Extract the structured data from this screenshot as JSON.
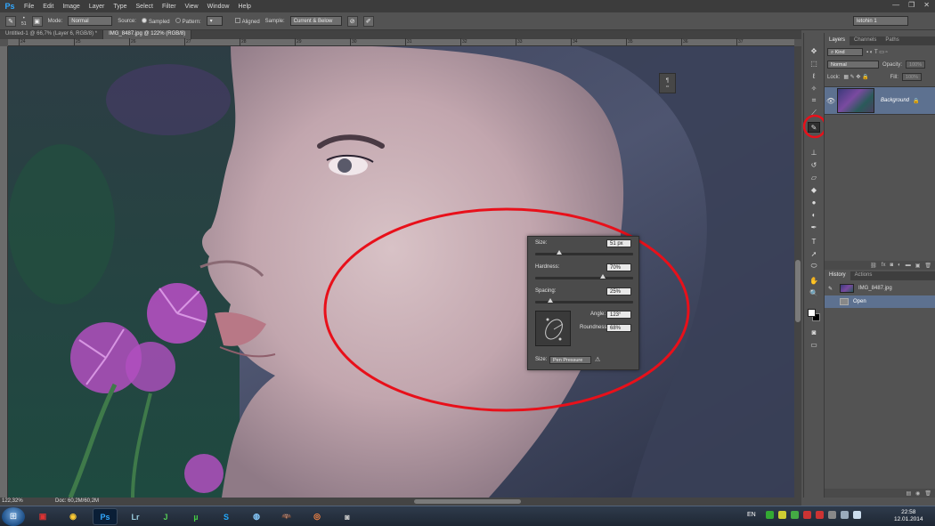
{
  "app": {
    "logo": "Ps"
  },
  "menu": [
    "File",
    "Edit",
    "Image",
    "Layer",
    "Type",
    "Select",
    "Filter",
    "View",
    "Window",
    "Help"
  ],
  "window_controls": {
    "minimize": "—",
    "restore": "❐",
    "close": "✕"
  },
  "options": {
    "brush_size": "51",
    "mode_label": "Mode:",
    "mode_value": "Normal",
    "source_label": "Source:",
    "sampled_label": "Sampled",
    "pattern_label": "Pattern:",
    "aligned_label": "Aligned",
    "sample_label": "Sample:",
    "sample_value": "Current & Below",
    "workspace_value": "letohin 1"
  },
  "doc_tabs": [
    {
      "label": "Untitled-1 @ 66,7% (Layer 6, RGB/8) *"
    },
    {
      "label": "IMG_8487.jpg @ 122% (RGB/8)"
    }
  ],
  "ruler_numbers": [
    "24",
    "25",
    "26",
    "27",
    "28",
    "29",
    "30",
    "31",
    "32",
    "33",
    "34",
    "35",
    "36",
    "37"
  ],
  "brush_panel": {
    "size_label": "Size:",
    "size_value": "51 px",
    "size_level": 0.23,
    "hardness_label": "Hardness:",
    "hardness_value": "70%",
    "hardness_level": 0.7,
    "spacing_label": "Spacing:",
    "spacing_value": "25%",
    "spacing_level": 0.13,
    "angle_label": "Angle:",
    "angle_value": "123°",
    "roundness_label": "Roundness:",
    "roundness_value": "68%",
    "size_control_label": "Size:",
    "size_control_value": "Pen Pressure"
  },
  "status": {
    "zoom": "122,32%",
    "doc": "Doc: 60,2M/60,2M"
  },
  "layers_panel": {
    "tabs": [
      "Layers",
      "Channels",
      "Paths"
    ],
    "filter_kind": "Kind",
    "blend_mode": "Normal",
    "opacity_label": "Opacity:",
    "opacity_value": "100%",
    "lock_label": "Lock:",
    "fill_label": "Fill:",
    "fill_value": "100%",
    "layer_name": "Background"
  },
  "history_panel": {
    "tabs": [
      "History",
      "Actions"
    ],
    "snapshot_name": "IMG_8487.jpg",
    "states": [
      "Open"
    ]
  },
  "taskbar": {
    "lang": "EN",
    "time": "22:58",
    "date": "12.01.2014"
  },
  "colors": {
    "annotation_red": "#e8101a",
    "selection_blue": "#5d7190",
    "panel_bg": "#535353"
  }
}
